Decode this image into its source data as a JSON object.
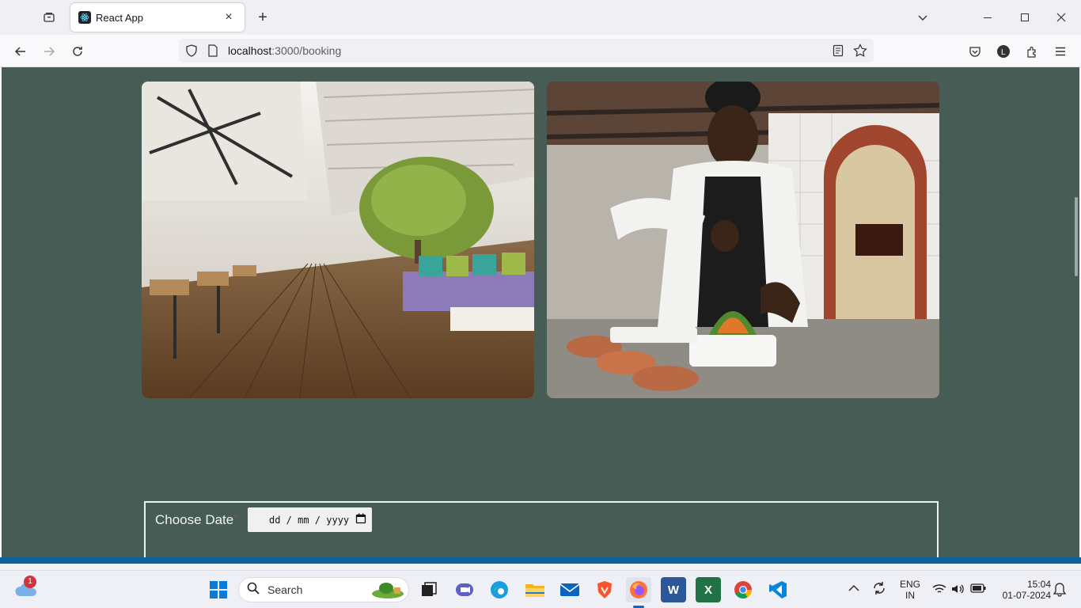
{
  "browser": {
    "tab": {
      "title": "React App",
      "close": "×"
    },
    "new_tab": "+",
    "url": {
      "host": "localhost",
      "path": ":3000/booking"
    }
  },
  "booking": {
    "choose_date_label": "Choose Date",
    "required_mark": "*",
    "date_placeholder": "dd / mm / yyyy"
  },
  "taskbar": {
    "weather_badge": "1",
    "search_placeholder": "Search",
    "lang_line1": "ENG",
    "lang_line2": "IN",
    "time": "15:04",
    "date": "01-07-2024",
    "apps": [
      {
        "name": "Word",
        "letter": "W",
        "color": "#2b579a"
      },
      {
        "name": "Excel",
        "letter": "X",
        "color": "#217346"
      }
    ]
  },
  "colors": {
    "page_bg": "#475c55",
    "accent": "#0a84ff"
  }
}
